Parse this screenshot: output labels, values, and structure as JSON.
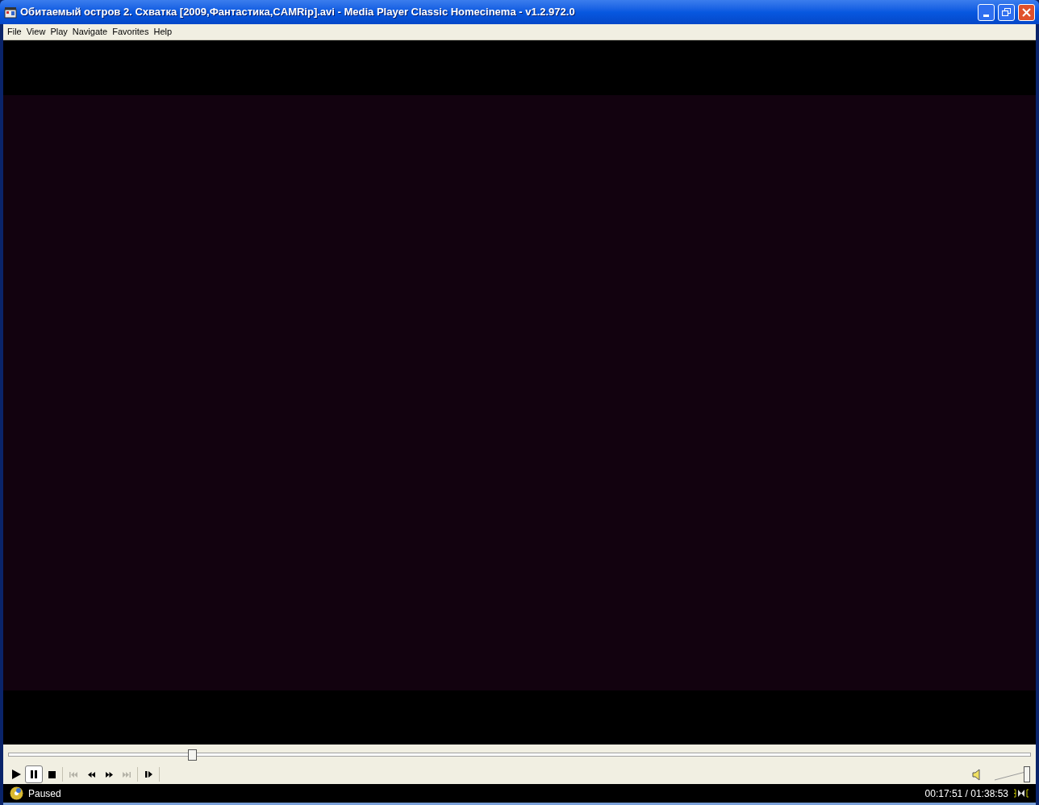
{
  "window": {
    "title": "Обитаемый остров 2. Схватка [2009,Фантастика,CAMRip].avi - Media Player Classic Homecinema - v1.2.972.0"
  },
  "menu": [
    "File",
    "View",
    "Play",
    "Navigate",
    "Favorites",
    "Help"
  ],
  "seek": {
    "level": 0.18
  },
  "controls": [
    {
      "kind": "play",
      "selected": false,
      "disabled": false
    },
    {
      "kind": "pause",
      "selected": true,
      "disabled": false
    },
    {
      "kind": "stop",
      "selected": false,
      "disabled": false
    },
    {
      "kind": "prev",
      "selected": false,
      "disabled": true
    },
    {
      "kind": "rewind",
      "selected": false,
      "disabled": false
    },
    {
      "kind": "forward",
      "selected": false,
      "disabled": false
    },
    {
      "kind": "next",
      "selected": false,
      "disabled": true
    },
    {
      "kind": "framestep",
      "selected": false,
      "disabled": false
    }
  ],
  "volume": {
    "level": 1
  },
  "status": {
    "text": "Paused",
    "time": "00:17:51 / 01:38:53"
  }
}
